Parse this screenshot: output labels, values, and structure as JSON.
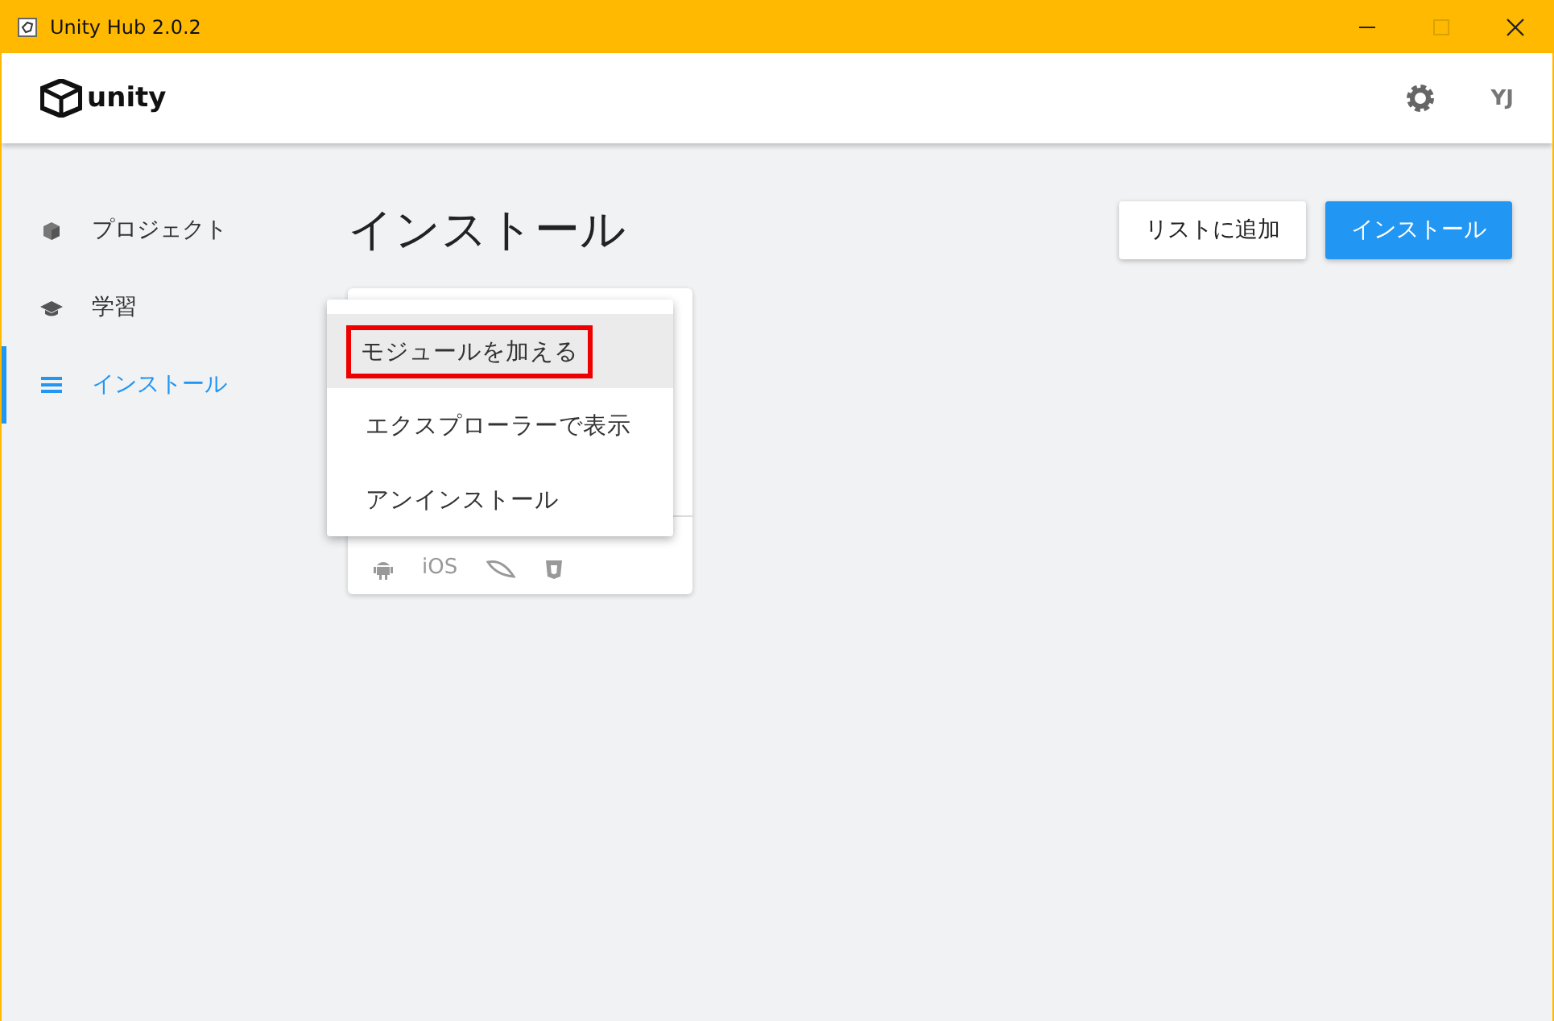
{
  "window": {
    "title": "Unity Hub 2.0.2"
  },
  "header": {
    "logo": "unity",
    "avatar": "YJ"
  },
  "sidebar": {
    "items": [
      {
        "label": "プロジェクト",
        "selected": false
      },
      {
        "label": "学習",
        "selected": false
      },
      {
        "label": "インストール",
        "selected": true
      }
    ]
  },
  "main": {
    "title": "インストール",
    "buttons": [
      {
        "label": "リストに追加",
        "kind": "secondary"
      },
      {
        "label": "インストール",
        "kind": "primary"
      }
    ],
    "card": {
      "platforms": [
        {
          "kind": "android"
        },
        {
          "kind": "text",
          "label": "iOS"
        },
        {
          "kind": "leaf"
        },
        {
          "kind": "shield"
        }
      ]
    },
    "menu": {
      "items": [
        {
          "label": "モジュールを加える",
          "selected": true,
          "boxed": true
        },
        {
          "label": "エクスプローラーで表示",
          "selected": false,
          "boxed": false
        },
        {
          "label": "アンインストール",
          "selected": false,
          "boxed": false
        }
      ]
    }
  }
}
